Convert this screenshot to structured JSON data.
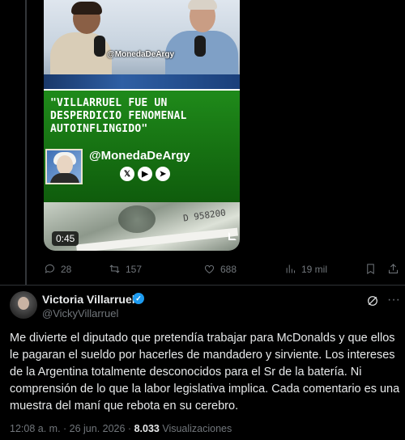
{
  "media": {
    "overlay_handle": "@MonedaDeArgy",
    "headline": "\"VILLARRUEL FUE UN DESPERDICIO FENOMENAL AUTOINFLINGIDO\"",
    "card_handle": "@MonedaDeArgy",
    "social_icons": [
      "x-icon",
      "youtube-icon",
      "telegram-icon"
    ],
    "social_glyphs": [
      "𝕏",
      "▶",
      "➤"
    ],
    "serial": "D 958200",
    "duration": "0:45"
  },
  "actions": {
    "replies": "28",
    "reposts": "157",
    "likes": "688",
    "views": "19 mil"
  },
  "tweet": {
    "display_name": "Victoria Villarruel",
    "handle": "@VickyVillarruel",
    "verified_mark": "✓",
    "more_glyph": "···",
    "text": "Me divierte el diputado que pretendía trabajar para McDonalds y que ellos le pagaran el sueldo por hacerles de mandadero y sirviente. Los intereses de la Argentina totalmente desconocidos para el Sr de la batería. Ni comprensión de lo que la labor legislativa implica. Cada comentario es una muestra del maní que rebota en su cerebro.",
    "time": "12:08 a. m. · 26 jun. 2026 · ",
    "view_count": "8.033",
    "views_label": " Visualizaciones"
  },
  "colors": {
    "background": "#000000",
    "text_primary": "#e7e9ea",
    "text_secondary": "#71767b",
    "verified": "#1d9bf0",
    "card_green": "#1f8a1a"
  }
}
